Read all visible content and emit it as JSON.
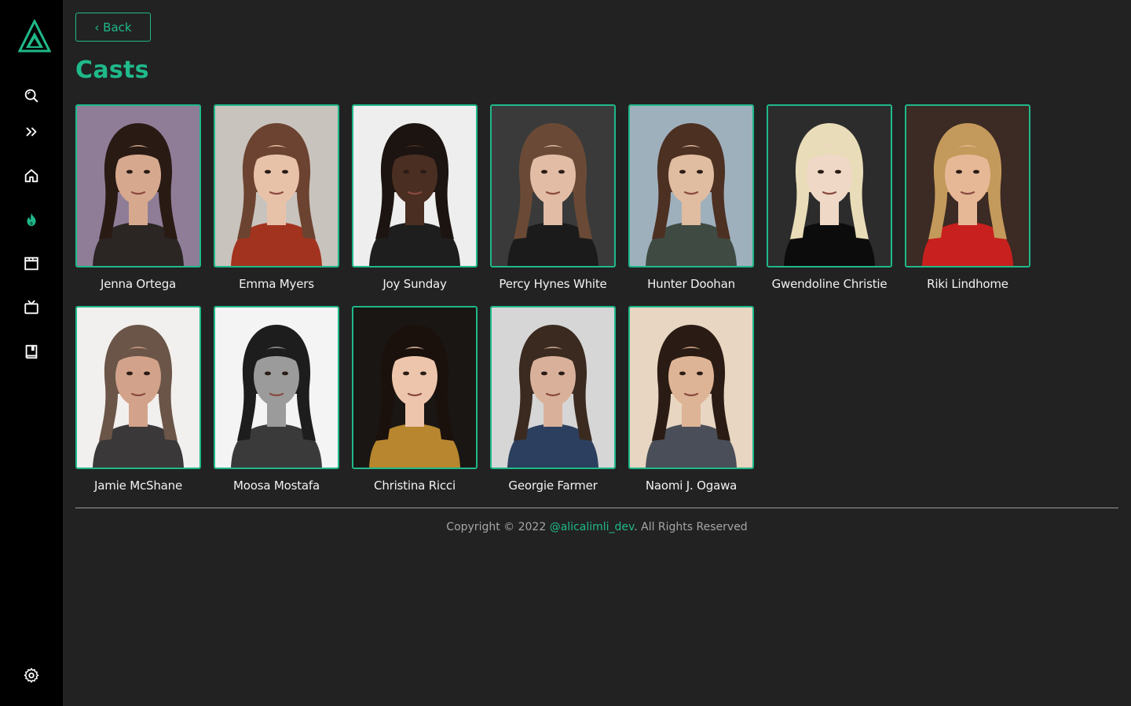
{
  "sidebar": {
    "logo": "triangle-logo",
    "nav": [
      {
        "icon": "search-icon",
        "active": false
      },
      {
        "icon": "double-chevron-right-icon",
        "active": false
      },
      {
        "icon": "home-icon",
        "active": false
      },
      {
        "icon": "flame-icon",
        "active": true
      },
      {
        "icon": "clapperboard-icon",
        "active": false
      },
      {
        "icon": "tv-icon",
        "active": false
      },
      {
        "icon": "book-icon",
        "active": false
      }
    ],
    "settings_icon": "gear-icon"
  },
  "header": {
    "back_label": "‹ Back",
    "title": "Casts"
  },
  "cast": [
    {
      "name": "Jenna Ortega",
      "bg": "#8f7d98",
      "skin": "#d6a98e",
      "hair": "#2a1a14",
      "shirt": "#2b2523"
    },
    {
      "name": "Emma Myers",
      "bg": "#c9c3bd",
      "skin": "#e8c2a8",
      "hair": "#6b4330",
      "shirt": "#a2331e"
    },
    {
      "name": "Joy Sunday",
      "bg": "#eeeeee",
      "skin": "#4a2e22",
      "hair": "#1c1410",
      "shirt": "#1e1e1e"
    },
    {
      "name": "Percy Hynes White",
      "bg": "#3a3a3a",
      "skin": "#e2bca4",
      "hair": "#6a4a36",
      "shirt": "#1b1b1b"
    },
    {
      "name": "Hunter Doohan",
      "bg": "#9fb0bd",
      "skin": "#e0bca0",
      "hair": "#4c3022",
      "shirt": "#3f4a42"
    },
    {
      "name": "Gwendoline Christie",
      "bg": "#2c2c2c",
      "skin": "#efd8c6",
      "hair": "#e9dcb8",
      "shirt": "#0c0c0c"
    },
    {
      "name": "Riki Lindhome",
      "bg": "#3c2a24",
      "skin": "#e6b896",
      "hair": "#c49a5c",
      "shirt": "#c8201e"
    },
    {
      "name": "Jamie McShane",
      "bg": "#f2f0ee",
      "skin": "#d2a38a",
      "hair": "#6b5548",
      "shirt": "#3a3838"
    },
    {
      "name": "Moosa Mostafa",
      "bg": "#f4f4f4",
      "skin": "#9b9b9b",
      "hair": "#1d1d1d",
      "shirt": "#3a3a3a"
    },
    {
      "name": "Christina Ricci",
      "bg": "#1a1614",
      "skin": "#ecc5ac",
      "hair": "#1a100c",
      "shirt": "#b8862e"
    },
    {
      "name": "Georgie Farmer",
      "bg": "#d6d6d6",
      "skin": "#d9b19a",
      "hair": "#3b2a20",
      "shirt": "#2c3f5e"
    },
    {
      "name": "Naomi J. Ogawa",
      "bg": "#e8d6c2",
      "skin": "#deb496",
      "hair": "#2a1c14",
      "shirt": "#4a4e58"
    }
  ],
  "footer": {
    "prefix": "Copyright © 2022 ",
    "link": "@alicalimli_dev",
    "suffix": ". All Rights Reserved"
  },
  "colors": {
    "accent": "#1fb98a",
    "background": "#222222",
    "sidebar": "#000000"
  }
}
